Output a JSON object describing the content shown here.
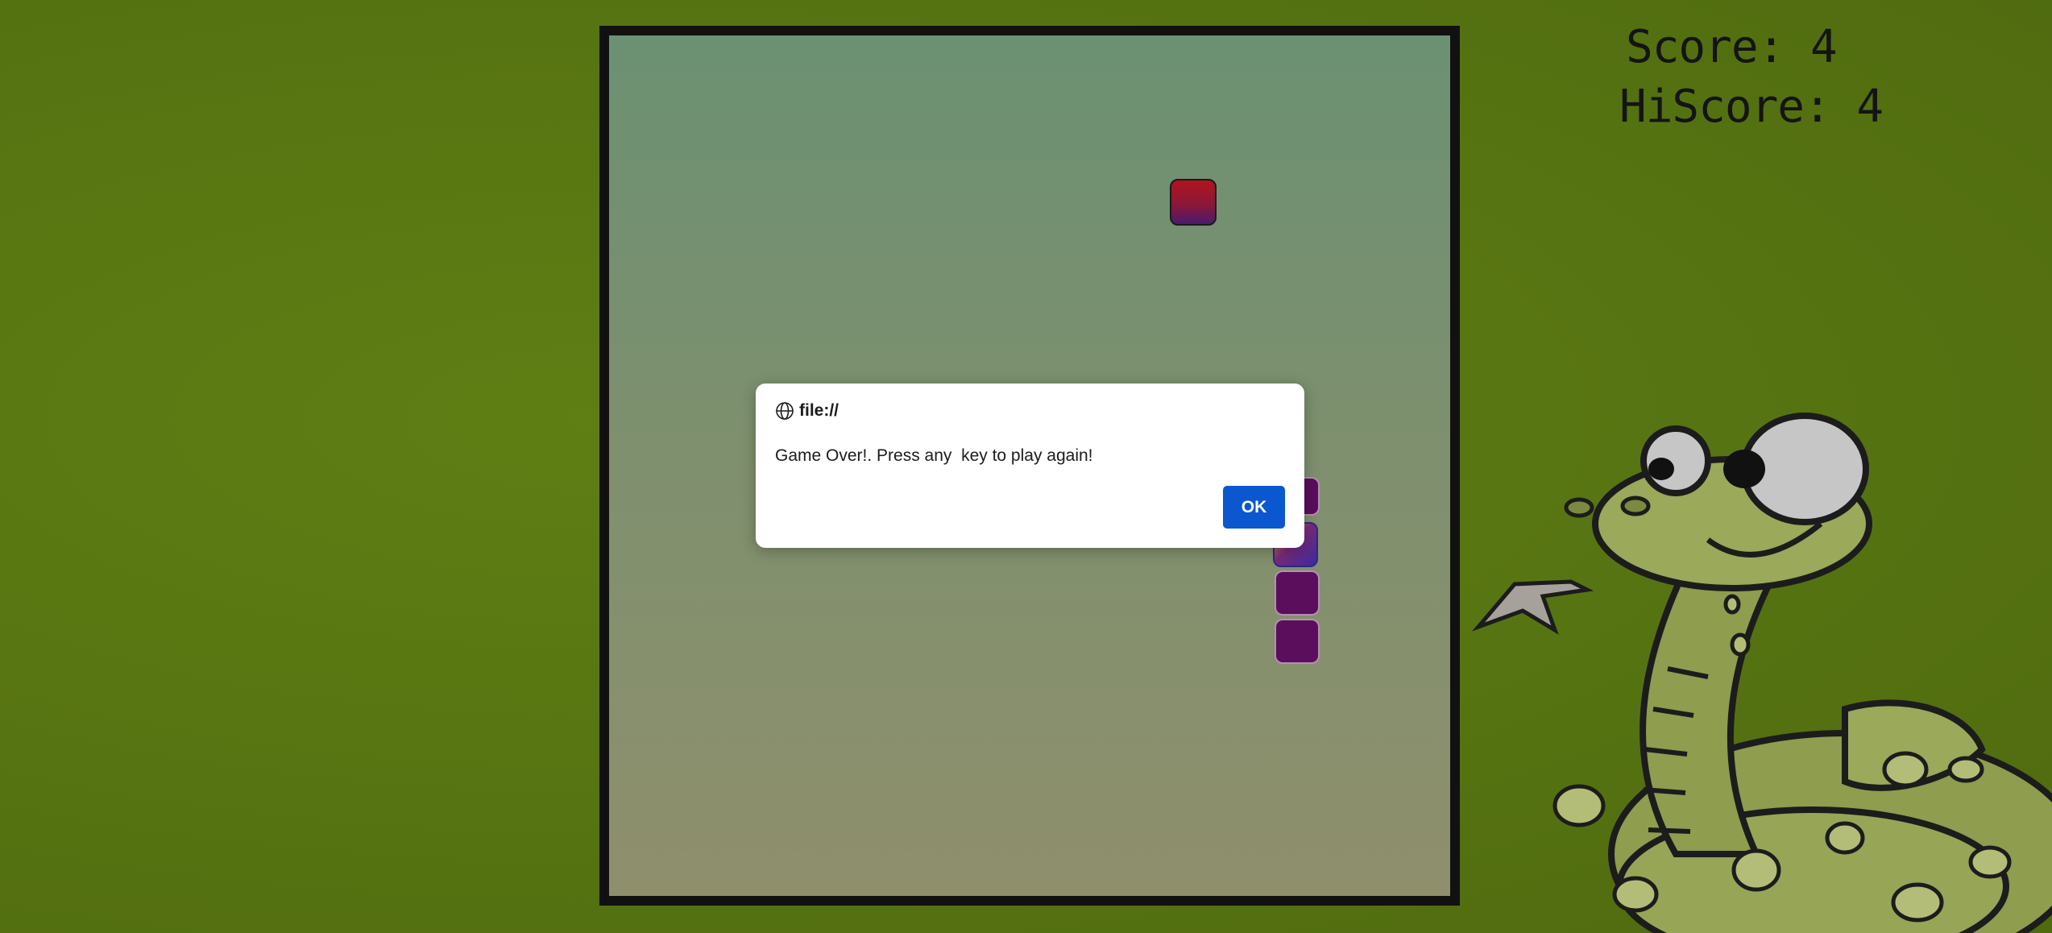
{
  "hud": {
    "score_text": "Score: 4",
    "hiscore_text": "HiScore: 4"
  },
  "game": {
    "food_color": "#b0141e",
    "snake_body_color": "#5a0e5c",
    "snake_head_colors": [
      "#e7b91b",
      "#3a2a9c"
    ],
    "board_border_color": "#111111"
  },
  "dialog": {
    "origin": "file://",
    "origin_icon": "globe-icon",
    "message": "Game Over!. Press any  key to play again!",
    "ok_label": "OK",
    "ok_color": "#0b57d0"
  }
}
